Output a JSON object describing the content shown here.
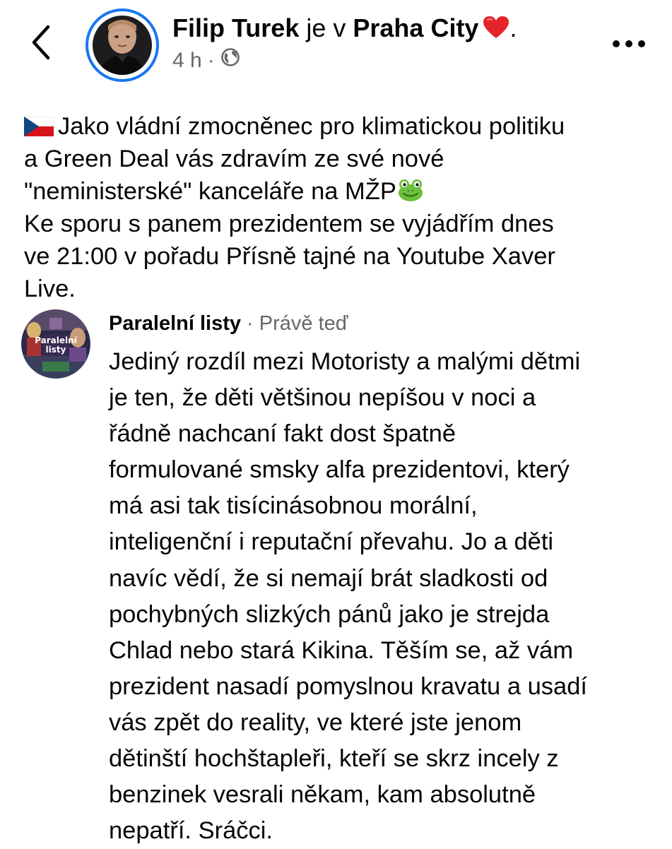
{
  "header": {
    "author": "Filip Turek",
    "connector": " je v ",
    "place": "Praha City",
    "trailing": ".",
    "time": "4 h",
    "separator": "·",
    "icons": {
      "back": "chevron-left-icon",
      "more": "more-dots-icon",
      "privacy": "globe-icon",
      "emoji": "red-heart-icon"
    }
  },
  "post": {
    "lines": [
      "Jako vládní zmocněnec pro klimatickou politiku",
      "a Green Deal vás zdravím ze své nové",
      "\"neministerské\" kanceláře na MŽP",
      "Ke sporu s panem prezidentem se vyjádřím dnes",
      "ve 21:00 v pořadu Přísně tajné na Youtube Xaver",
      "Live."
    ],
    "icons": {
      "flag": "czech-flag-icon",
      "frog": "frog-icon"
    }
  },
  "comment": {
    "author": "Paralelní listy",
    "separator": " · ",
    "time": "Právě teď",
    "avatar_text": "Paralelní listy",
    "lines": [
      "Jediný rozdíl mezi Motoristy a malými dětmi",
      "je ten, že děti většinou nepíšou v noci a",
      "řádně nachcaní fakt dost špatně",
      "formulované smsky alfa prezidentovi, který",
      "má asi tak tisícinásobnou morální,",
      "inteligenční i reputační převahu. Jo a děti",
      "navíc vědí, že si nemají brát sladkosti od",
      "pochybných slizkých pánů jako je strejda",
      "Chlad nebo stará Kikina. Těším se, až vám",
      "prezident nasadí pomyslnou kravatu a usadí",
      "vás zpět do reality, ve které jste jenom",
      "dětinští hochštapleři, kteří se skrz incely z",
      "benzinek vesrali někam, kam absolutně",
      "nepatří. Sráčci."
    ]
  },
  "colors": {
    "accent": "#1877f2",
    "text": "#050505",
    "secondary": "#65676b"
  }
}
